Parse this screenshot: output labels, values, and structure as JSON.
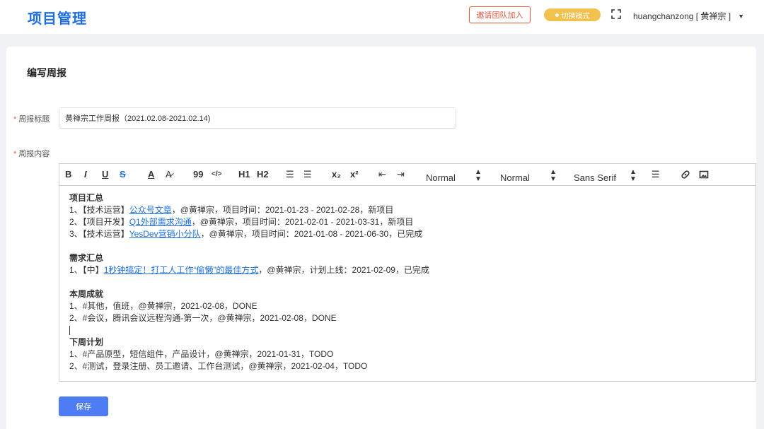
{
  "header": {
    "app_title": "项目管理",
    "invite_label": "邀请团队加入",
    "mode_label": "切换模式",
    "user_label": "huangchanzong [ 黄禅宗 ]"
  },
  "page": {
    "title": "编写周报"
  },
  "form": {
    "title_label": "周报标题",
    "title_value": "黄禅宗工作周报（2021.02.08-2021.02.14)",
    "content_label": "周报内容",
    "save_label": "保存"
  },
  "toolbar": {
    "bold": "B",
    "italic": "I",
    "underline": "U",
    "strike": "S",
    "color": "A",
    "background": "A̷",
    "blockquote": "99",
    "code": "</>",
    "h1": "H1",
    "h2": "H2",
    "ordered_list": "☰",
    "bullet_list": "☰",
    "subscript": "x₂",
    "superscript": "x²",
    "outdent": "⇤",
    "indent": "⇥",
    "size_select": "Normal",
    "header_select": "Normal",
    "font_select": "Sans Serif",
    "align": "☰",
    "link": "🔗",
    "image": "▣"
  },
  "editor": {
    "s1_title": "项目汇总",
    "s1_items": [
      {
        "prefix": "1、【技术运营】",
        "link": "公众号文章",
        "suffix": "，@黄禅宗，项目时间：2021-01-23 - 2021-02-28，新项目"
      },
      {
        "prefix": "2、【项目开发】",
        "link": "Q1外部需求沟通",
        "suffix": "，@黄禅宗，项目时间：2021-02-01 - 2021-03-31，新项目"
      },
      {
        "prefix": "3、【技术运营】",
        "link": "YesDev营销小分队",
        "suffix": "，@黄禅宗，项目时间：2021-01-08 - 2021-06-30，已完成"
      }
    ],
    "s2_title": "需求汇总",
    "s2_items": [
      {
        "prefix": "1、【中】",
        "link": "1秒钟搞定！打工人工作“偷懒”的最佳方式",
        "suffix": "，@黄禅宗，计划上线：2021-02-09，已完成"
      }
    ],
    "s3_title": "本周成就",
    "s3_items": [
      "1、#其他，值班，@黄禅宗，2021-02-08，DONE",
      "2、#会议，腾讯会议远程沟通-第一次，@黄禅宗，2021-02-08，DONE"
    ],
    "s4_title": "下周计划",
    "s4_items": [
      "1、#产品原型，短信组件，产品设计，@黄禅宗，2021-01-31，TODO",
      "2、#测试，登录注册、员工邀请、工作台测试，@黄禅宗，2021-02-04，TODO"
    ]
  },
  "colors": {
    "brand_blue": "#1f6fe0",
    "invite_red": "#e0593f",
    "mode_yellow": "#f2c14e",
    "save_blue": "#4d7cf4"
  }
}
